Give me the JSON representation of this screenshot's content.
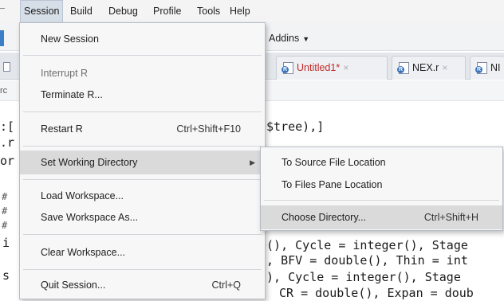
{
  "menubar": {
    "items": [
      "Session",
      "Build",
      "Debug",
      "Profile",
      "Tools",
      "Help"
    ],
    "active": "Session"
  },
  "toolbar": {
    "addins_label": "Addins"
  },
  "tabs": [
    {
      "label": "Untitled1*",
      "modified": true
    },
    {
      "label": "NEX.r",
      "modified": false
    },
    {
      "label": "NI",
      "modified": false
    }
  ],
  "editor": {
    "code_line_1": "e$tree),]",
    "code_line_2": "e(), Cycle = integer(), Stage",
    "code_line_3": "), BFV = double(), Thin = int",
    "code_line_4": "(), Cycle = integer(), Stage",
    "code_line_5": "CR = double(), Expan = doub",
    "left_fragments": [
      "rc",
      ":[",
      ".r",
      "or",
      "#",
      "#",
      "#",
      "i",
      "s"
    ]
  },
  "session_menu": {
    "items": [
      {
        "label": "New Session",
        "shortcut": "",
        "enabled": true
      },
      {
        "label": "Interrupt R",
        "shortcut": "",
        "enabled": false
      },
      {
        "label": "Terminate R...",
        "shortcut": "",
        "enabled": true
      },
      {
        "label": "Restart R",
        "shortcut": "Ctrl+Shift+F10",
        "enabled": true
      },
      {
        "label": "Set Working Directory",
        "shortcut": "",
        "enabled": true,
        "submenu": true,
        "highlighted": true
      },
      {
        "label": "Load Workspace...",
        "shortcut": "",
        "enabled": true
      },
      {
        "label": "Save Workspace As...",
        "shortcut": "",
        "enabled": true
      },
      {
        "label": "Clear Workspace...",
        "shortcut": "",
        "enabled": true
      },
      {
        "label": "Quit Session...",
        "shortcut": "Ctrl+Q",
        "enabled": true
      }
    ]
  },
  "wd_submenu": {
    "items": [
      {
        "label": "To Source File Location",
        "shortcut": ""
      },
      {
        "label": "To Files Pane Location",
        "shortcut": ""
      },
      {
        "label": "Choose Directory...",
        "shortcut": "Ctrl+Shift+H",
        "highlighted": true
      }
    ]
  },
  "colors": {
    "accent_blue": "#3b74b9",
    "modified_tab_red": "#c22a2a",
    "highlight": "#dadada"
  },
  "icons": [
    "r-document-icon",
    "close-tab-icon",
    "submenu-arrow-icon",
    "dropdown-caret-icon"
  ]
}
